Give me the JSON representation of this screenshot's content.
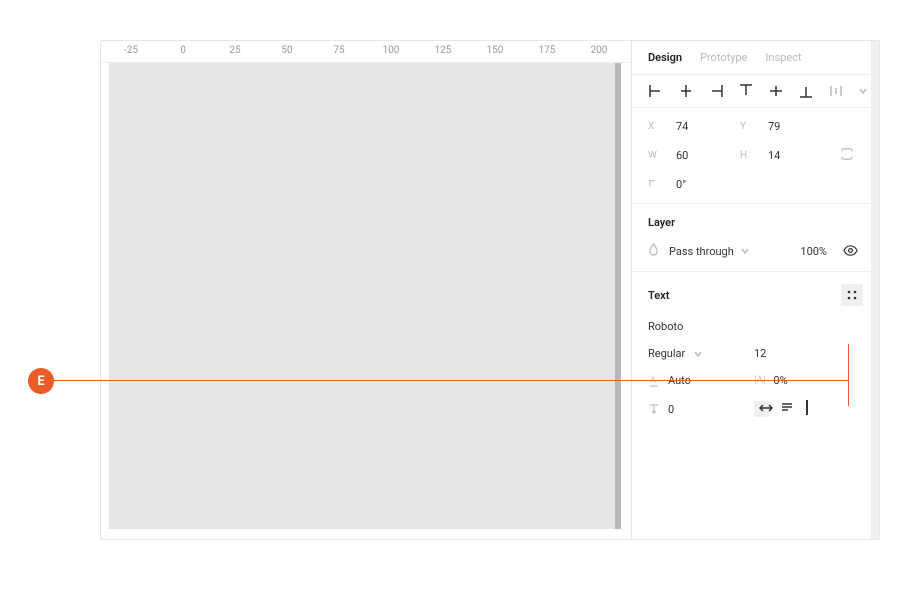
{
  "annotation": {
    "letter": "E"
  },
  "ruler": {
    "ticks": [
      "-25",
      "0",
      "25",
      "50",
      "75",
      "100",
      "125",
      "150",
      "175",
      "200"
    ]
  },
  "panel": {
    "tabs": {
      "design": "Design",
      "prototype": "Prototype",
      "inspect": "Inspect"
    },
    "position": {
      "x_label": "X",
      "x": "74",
      "y_label": "Y",
      "y": "79",
      "w_label": "W",
      "w": "60",
      "h_label": "H",
      "h": "14",
      "r_label": "⌐",
      "rotation": "0°"
    },
    "layer": {
      "title": "Layer",
      "blend_mode": "Pass through",
      "opacity": "100%"
    },
    "text": {
      "title": "Text",
      "font": "Roboto",
      "weight": "Regular",
      "size": "12",
      "line_height_label": "A̲",
      "line_height": "Auto",
      "letter_spacing_label": "|A|",
      "letter_spacing": "0%",
      "paragraph_spacing": "0"
    }
  }
}
